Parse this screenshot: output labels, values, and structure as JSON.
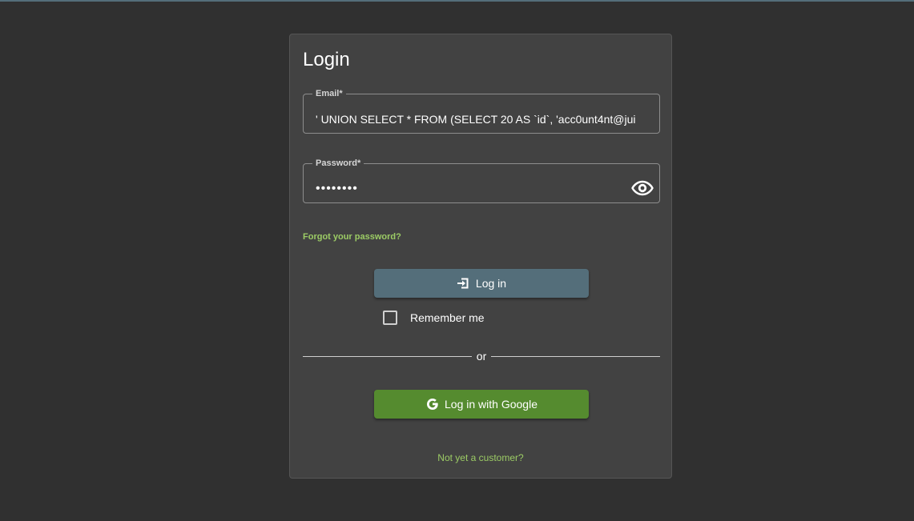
{
  "login": {
    "title": "Login",
    "email": {
      "label": "Email*",
      "value": "' UNION SELECT * FROM (SELECT 20 AS `id`, 'acc0unt4nt@jui"
    },
    "password": {
      "label": "Password*",
      "value": "password",
      "visibility_icon": "eye-icon"
    },
    "forgot_password": "Forgot your password?",
    "login_button": {
      "label": "Log in",
      "icon": "login-icon"
    },
    "remember_me": {
      "label": "Remember me",
      "checked": false
    },
    "divider_text": "or",
    "google_button": {
      "label": "Log in with Google",
      "icon": "google-icon"
    },
    "not_customer": "Not yet a customer?"
  },
  "colors": {
    "background": "#303030",
    "card": "#424242",
    "primary": "#546e7a",
    "accent": "#558b2f",
    "link": "#9ccc65"
  }
}
